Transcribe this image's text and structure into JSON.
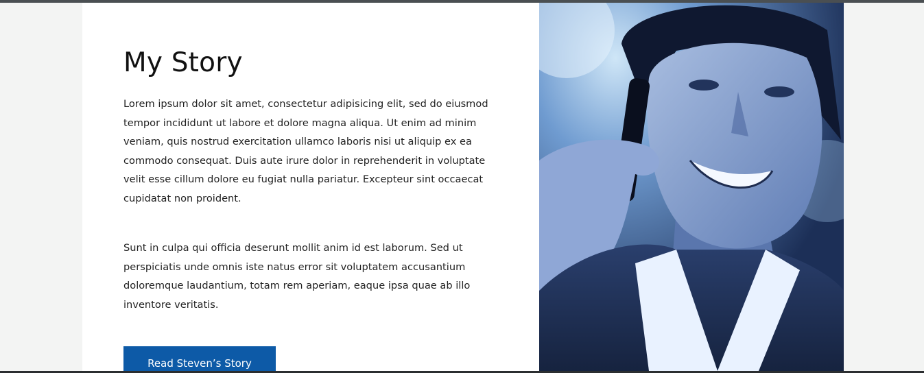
{
  "story": {
    "title": "My Story",
    "paragraph_1": "Lorem ipsum dolor sit amet, consectetur adipisicing elit, sed do eiusmod tempor incididunt ut labore et dolore magna aliqua. Ut enim ad minim veniam, quis nostrud exercitation ullamco laboris nisi ut aliquip ex ea commodo consequat. Duis aute irure dolor in reprehenderit in voluptate velit esse cillum dolore eu fugiat nulla pariatur. Excepteur sint occaecat cupidatat non proident.",
    "paragraph_2": "Sunt in culpa qui officia deserunt mollit anim id est laborum. Sed ut perspiciatis unde omnis iste natus error sit voluptatem accusantium doloremque laudantium, totam rem aperiam, eaque ipsa quae ab illo inventore veritatis.",
    "button_label": "Read Steven’s Story"
  },
  "colors": {
    "button_background": "#0d5aa7",
    "page_background": "#f3f4f3",
    "card_background": "#ffffff",
    "photo_tint": "#2a4a86"
  }
}
